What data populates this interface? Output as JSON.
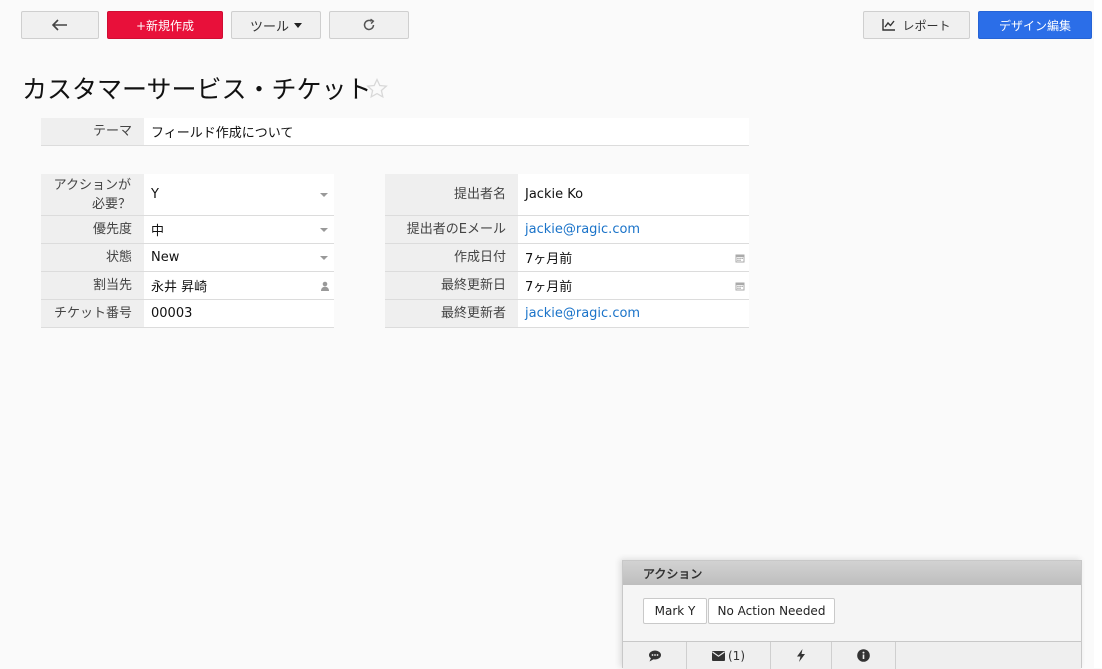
{
  "toolbar": {
    "back_icon": "arrow-left-icon",
    "new_label": "+新規作成",
    "tools_label": "ツール",
    "refresh_icon": "refresh-icon",
    "report_label": "レポート",
    "design_label": "デザイン編集"
  },
  "page": {
    "title": "カスタマーサービス・チケット"
  },
  "theme": {
    "label": "テーマ",
    "value": "フィールド作成について"
  },
  "left_fields": [
    {
      "label": "アクションが必要？",
      "value": "Y"
    },
    {
      "label": "優先度",
      "value": "中"
    },
    {
      "label": "状態",
      "value": "New"
    },
    {
      "label": "割当先",
      "value": "永井 昇崎"
    },
    {
      "label": "チケット番号",
      "value": "00003"
    }
  ],
  "right_fields": [
    {
      "label": "提出者名",
      "value": "Jackie Ko"
    },
    {
      "label": "提出者のEメール",
      "value": "jackie@ragic.com"
    },
    {
      "label": "作成日付",
      "value": "7ヶ月前"
    },
    {
      "label": "最終更新日",
      "value": "7ヶ月前"
    },
    {
      "label": "最終更新者",
      "value": "jackie@ragic.com"
    }
  ],
  "action_panel": {
    "title": "アクション",
    "buttons": [
      "Mark Y",
      "No Action Needed"
    ],
    "footer": {
      "mail_count": "(1)"
    }
  },
  "colors": {
    "new_button": "#e8103a",
    "design_button": "#2b6ee8",
    "link": "#1a73c9"
  }
}
